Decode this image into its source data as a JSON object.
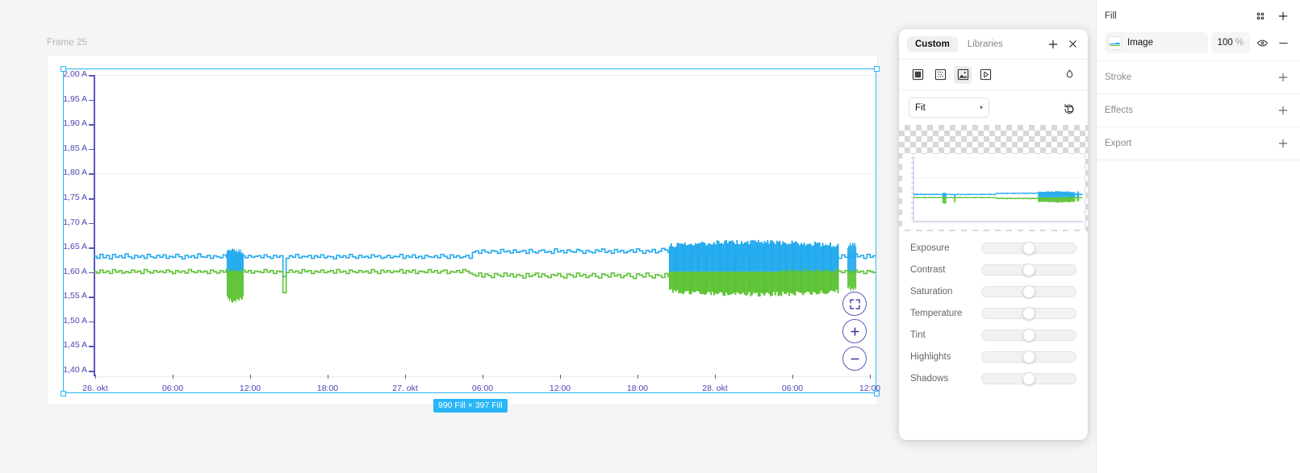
{
  "canvas": {
    "frame_label": "Frame 25",
    "size_badge": "990 Fill × 397 Fill",
    "zoom_controls": [
      {
        "name": "fit-to-screen",
        "glyph": "expand"
      },
      {
        "name": "zoom-in",
        "glyph": "+"
      },
      {
        "name": "zoom-out",
        "glyph": "−"
      }
    ]
  },
  "chart_data": {
    "type": "line",
    "title": "",
    "xlabel": "",
    "ylabel": "",
    "ylim": [
      1.4,
      2.0
    ],
    "y_tick_labels": [
      "2,00 A",
      "1,95 A",
      "1,90 A",
      "1,85 A",
      "1,80 A",
      "1,75 A",
      "1,70 A",
      "1,65 A",
      "1,60 A",
      "1,55 A",
      "1,50 A",
      "1,45 A",
      "1,40 A"
    ],
    "y_tick_values": [
      2.0,
      1.95,
      1.9,
      1.85,
      1.8,
      1.75,
      1.7,
      1.65,
      1.6,
      1.55,
      1.5,
      1.45,
      1.4
    ],
    "x_tick_labels": [
      "26. okt",
      "06:00",
      "12:00",
      "18:00",
      "27. okt",
      "06:00",
      "12:00",
      "18:00",
      "28. okt",
      "06:00",
      "12:00"
    ],
    "gridlines_at": [
      2.0,
      1.8,
      1.6
    ],
    "grid": true,
    "legend": "none",
    "series": [
      {
        "name": "current-blue",
        "color": "#22aaee",
        "baseline": 1.632,
        "values": [
          1.632,
          1.628,
          1.636,
          1.629,
          1.634,
          1.627,
          1.636,
          1.63,
          1.633,
          1.629,
          1.637,
          1.631,
          1.628,
          1.634,
          1.63,
          1.633,
          1.628,
          1.636,
          1.631,
          1.629,
          1.634,
          1.63,
          1.635,
          1.628,
          1.632,
          1.63,
          1.636,
          1.631,
          1.627,
          1.634,
          1.63,
          1.633,
          1.629,
          1.637,
          1.631,
          1.63,
          1.634,
          1.628,
          1.633,
          1.631,
          1.629,
          1.635,
          1.63,
          1.632,
          1.628,
          1.636,
          1.631,
          1.633,
          1.629,
          1.634,
          1.63,
          1.632,
          1.633,
          1.629,
          1.635,
          1.631,
          1.628,
          1.634,
          1.63,
          1.633,
          1.591,
          1.628,
          1.633,
          1.63,
          1.636,
          1.629,
          1.632,
          1.631,
          1.634,
          1.628,
          1.633,
          1.63,
          1.635,
          1.629,
          1.632,
          1.631,
          1.627,
          1.634,
          1.63,
          1.633,
          1.629,
          1.636,
          1.631,
          1.628,
          1.634,
          1.63,
          1.632,
          1.629,
          1.635,
          1.631,
          1.633,
          1.628,
          1.63,
          1.634,
          1.629,
          1.632,
          1.631,
          1.636,
          1.628,
          1.633,
          1.63,
          1.635,
          1.629,
          1.632,
          1.628,
          1.634,
          1.631,
          1.63,
          1.633,
          1.629,
          1.636,
          1.632,
          1.628,
          1.635,
          1.63,
          1.633,
          1.629,
          1.631,
          1.634,
          1.628,
          1.64,
          1.643,
          1.638,
          1.645,
          1.641,
          1.639,
          1.644,
          1.642,
          1.638,
          1.646,
          1.641,
          1.643,
          1.639,
          1.645,
          1.64,
          1.642,
          1.644,
          1.638,
          1.646,
          1.641,
          1.639,
          1.643,
          1.645,
          1.64,
          1.642,
          1.638,
          1.647,
          1.641,
          1.644,
          1.639,
          1.645,
          1.642,
          1.64,
          1.646,
          1.643,
          1.638,
          1.644,
          1.641,
          1.639,
          1.645,
          1.642,
          1.647,
          1.64,
          1.643,
          1.638,
          1.646,
          1.641,
          1.644,
          1.639,
          1.642,
          1.645,
          1.64,
          1.647,
          1.643,
          1.638,
          1.644,
          1.641,
          1.646,
          1.639,
          1.642,
          1.648,
          1.645,
          1.64,
          1.643,
          1.638,
          1.647,
          1.641,
          1.644,
          1.642,
          1.639,
          1.646,
          1.643,
          1.64,
          1.645,
          1.638,
          1.642,
          1.647,
          1.641,
          1.644,
          1.639,
          1.643,
          1.646,
          1.64,
          1.642,
          1.638,
          1.645,
          1.641,
          1.647,
          1.643,
          1.639,
          1.644,
          1.64,
          1.646,
          1.642,
          1.638,
          1.645,
          1.641,
          1.643,
          1.639,
          1.632,
          1.634,
          1.63,
          1.636,
          1.631,
          1.629,
          1.635,
          1.633,
          1.628,
          1.637,
          1.632,
          1.63,
          1.634,
          1.629,
          1.636,
          1.631,
          1.633,
          1.628,
          1.635,
          1.63,
          1.632,
          1.629,
          1.637,
          1.631,
          1.634,
          1.628,
          1.636,
          1.63,
          1.633
        ]
      },
      {
        "name": "current-green",
        "color": "#5cc334",
        "baseline": 1.601,
        "values": [
          1.601,
          1.598,
          1.604,
          1.599,
          1.602,
          1.597,
          1.605,
          1.6,
          1.603,
          1.598,
          1.601,
          1.599,
          1.604,
          1.6,
          1.602,
          1.597,
          1.605,
          1.601,
          1.598,
          1.603,
          1.6,
          1.602,
          1.599,
          1.604,
          1.601,
          1.597,
          1.603,
          1.6,
          1.602,
          1.598,
          1.605,
          1.601,
          1.599,
          1.603,
          1.6,
          1.602,
          1.597,
          1.604,
          1.601,
          1.598,
          1.603,
          1.6,
          1.605,
          1.599,
          1.602,
          1.601,
          1.597,
          1.604,
          1.6,
          1.603,
          1.598,
          1.602,
          1.601,
          1.599,
          1.605,
          1.6,
          1.603,
          1.597,
          1.602,
          1.601,
          1.558,
          1.599,
          1.604,
          1.6,
          1.602,
          1.598,
          1.605,
          1.601,
          1.603,
          1.597,
          1.602,
          1.6,
          1.604,
          1.599,
          1.601,
          1.603,
          1.598,
          1.605,
          1.6,
          1.602,
          1.597,
          1.604,
          1.601,
          1.599,
          1.603,
          1.6,
          1.602,
          1.598,
          1.605,
          1.601,
          1.597,
          1.604,
          1.6,
          1.603,
          1.599,
          1.602,
          1.601,
          1.605,
          1.598,
          1.603,
          1.6,
          1.604,
          1.597,
          1.602,
          1.601,
          1.599,
          1.605,
          1.6,
          1.603,
          1.598,
          1.602,
          1.604,
          1.597,
          1.601,
          1.6,
          1.603,
          1.599,
          1.605,
          1.602,
          1.598,
          1.595,
          1.592,
          1.598,
          1.59,
          1.596,
          1.593,
          1.589,
          1.597,
          1.594,
          1.591,
          1.598,
          1.592,
          1.596,
          1.59,
          1.595,
          1.593,
          1.588,
          1.597,
          1.591,
          1.594,
          1.598,
          1.59,
          1.596,
          1.592,
          1.589,
          1.595,
          1.593,
          1.597,
          1.591,
          1.588,
          1.596,
          1.594,
          1.59,
          1.598,
          1.592,
          1.595,
          1.589,
          1.593,
          1.597,
          1.591,
          1.588,
          1.596,
          1.594,
          1.59,
          1.598,
          1.592,
          1.595,
          1.589,
          1.593,
          1.597,
          1.591,
          1.587,
          1.596,
          1.594,
          1.59,
          1.598,
          1.592,
          1.588,
          1.595,
          1.593,
          1.589,
          1.597,
          1.591,
          1.594,
          1.587,
          1.596,
          1.59,
          1.598,
          1.592,
          1.595,
          1.588,
          1.593,
          1.597,
          1.591,
          1.589,
          1.596,
          1.594,
          1.587,
          1.598,
          1.592,
          1.59,
          1.595,
          1.593,
          1.588,
          1.597,
          1.591,
          1.596,
          1.589,
          1.594,
          1.598,
          1.592,
          1.59,
          1.595,
          1.587,
          1.593,
          1.597,
          1.591,
          1.594,
          1.602,
          1.599,
          1.604,
          1.598,
          1.603,
          1.601,
          1.597,
          1.605,
          1.6,
          1.602,
          1.599,
          1.604,
          1.598,
          1.601,
          1.603,
          1.597,
          1.6,
          1.605,
          1.602,
          1.599,
          1.603,
          1.601,
          1.598,
          1.604,
          1.6,
          1.602,
          1.597,
          1.603,
          1.601,
          1.599
        ]
      }
    ],
    "fill_events": [
      {
        "name": "dip-event-1",
        "x_start_pct": 17.0,
        "x_end_pct": 19.1,
        "blue_top": 1.639,
        "blue_bottom": 1.601,
        "green_top": 1.601,
        "green_bottom": 1.547
      },
      {
        "name": "noise-band-main",
        "x_start_pct": 73.5,
        "x_end_pct": 95.0,
        "blue_top": 1.655,
        "blue_bottom": 1.601,
        "green_top": 1.601,
        "green_bottom": 1.561
      },
      {
        "name": "spike-event-2",
        "x_start_pct": 96.3,
        "x_end_pct": 97.4,
        "blue_top": 1.652,
        "blue_bottom": 1.601,
        "green_top": 1.601,
        "green_bottom": 1.57
      }
    ]
  },
  "fill_panel": {
    "tabs": [
      {
        "label": "Custom",
        "active": true
      },
      {
        "label": "Libraries",
        "active": false
      }
    ],
    "add_label": "+",
    "close_label": "×",
    "eyedropper_icon": "eyedropper-icon",
    "type_buttons": [
      {
        "name": "solid-fill-icon",
        "active": false
      },
      {
        "name": "gradient-fill-icon",
        "active": false
      },
      {
        "name": "image-fill-icon",
        "active": true
      },
      {
        "name": "video-fill-icon",
        "active": false
      }
    ],
    "scale_mode": "Fit",
    "rotate_icon": "rotate-image-icon",
    "adjustments": [
      {
        "label": "Exposure",
        "value": 50
      },
      {
        "label": "Contrast",
        "value": 50
      },
      {
        "label": "Saturation",
        "value": 50
      },
      {
        "label": "Temperature",
        "value": 50
      },
      {
        "label": "Tint",
        "value": 50
      },
      {
        "label": "Highlights",
        "value": 50
      },
      {
        "label": "Shadows",
        "value": 50
      }
    ]
  },
  "right_panel": {
    "sections": [
      {
        "title": "Fill",
        "name": "fill"
      },
      {
        "title": "Stroke",
        "name": "stroke"
      },
      {
        "title": "Effects",
        "name": "effects"
      },
      {
        "title": "Export",
        "name": "export"
      }
    ],
    "fill_item": {
      "type_label": "Image",
      "opacity": "100",
      "percent": "%"
    }
  },
  "colors": {
    "selection_blue": "#29b6f6",
    "series_blue": "#22aaee",
    "series_green": "#5cc334",
    "axis_indigo": "#5B57B8"
  }
}
